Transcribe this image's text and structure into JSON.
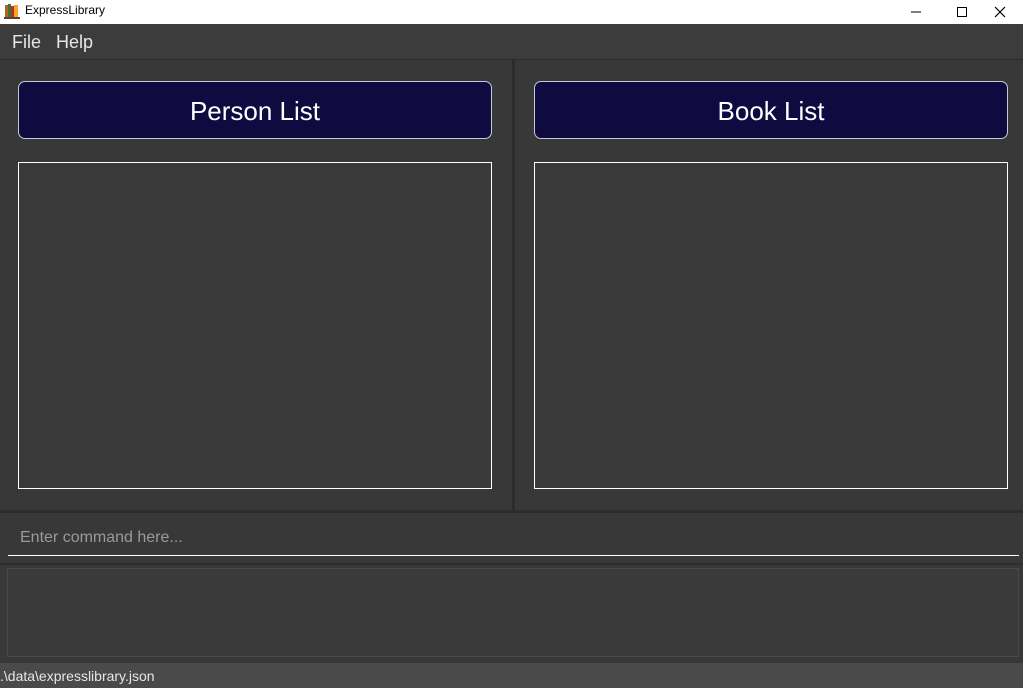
{
  "window": {
    "title": "ExpressLibrary",
    "icon": "books-icon"
  },
  "menu": {
    "items": [
      {
        "label": "File"
      },
      {
        "label": "Help"
      }
    ]
  },
  "panels": {
    "person": {
      "header": "Person List",
      "items": []
    },
    "book": {
      "header": "Book List",
      "items": []
    }
  },
  "command": {
    "value": "",
    "placeholder": "Enter command here..."
  },
  "result": {
    "text": ""
  },
  "status": {
    "path": ".\\data\\expresslibrary.json"
  },
  "colors": {
    "header_bg": "#0f0a40",
    "panel_bg": "#383838"
  }
}
